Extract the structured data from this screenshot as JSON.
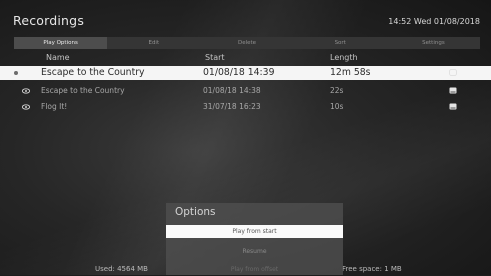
{
  "header": {
    "title": "Recordings",
    "clock": "14:52 Wed 01/08/2018"
  },
  "tabs": [
    "Play Options",
    "Edit",
    "Delete",
    "Sort",
    "Settings"
  ],
  "columns": {
    "name": "Name",
    "start": "Start",
    "length": "Length"
  },
  "recordings": [
    {
      "name": "Escape to the Country",
      "start": "01/08/18  14:39",
      "length": "12m 58s",
      "status_icon": "dot-icon",
      "selected": true
    },
    {
      "name": "Escape to the Country",
      "start": "01/08/18  14:38",
      "length": "22s",
      "status_icon": "eye-icon",
      "selected": false
    },
    {
      "name": "Flog It!",
      "start": "31/07/18  16:23",
      "length": "10s",
      "status_icon": "eye-icon",
      "selected": false
    }
  ],
  "options_dialog": {
    "title": "Options",
    "items": [
      "Play from start",
      "Resume",
      "Play from offset"
    ],
    "selected_index": 0
  },
  "footer": {
    "used": "Used: 4564 MB",
    "free": "Free space: 1 MB"
  }
}
